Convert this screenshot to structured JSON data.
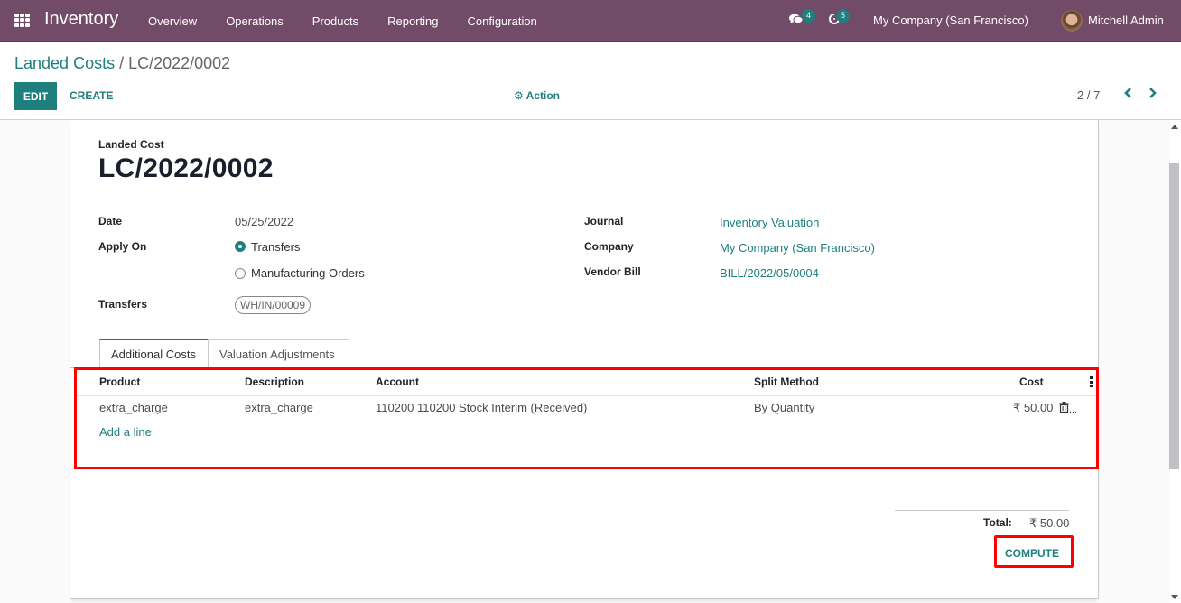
{
  "navbar": {
    "app_name": "Inventory",
    "menu": [
      "Overview",
      "Operations",
      "Products",
      "Reporting",
      "Configuration"
    ],
    "messages_count": "4",
    "activities_count": "5",
    "company": "My Company (San Francisco)",
    "user": "Mitchell Admin"
  },
  "breadcrumb": {
    "parent": "Landed Costs",
    "separator": " / ",
    "current": "LC/2022/0002"
  },
  "toolbar": {
    "edit_label": "EDIT",
    "create_label": "CREATE",
    "action_label": "Action",
    "pager": "2 / 7",
    "prev_icon": "‹",
    "next_icon": "›"
  },
  "form": {
    "subtitle": "Landed Cost",
    "title": "LC/2022/0002",
    "date_label": "Date",
    "date_value": "05/25/2022",
    "apply_on_label": "Apply On",
    "apply_on_options": [
      "Transfers",
      "Manufacturing Orders"
    ],
    "apply_on_selected": "Transfers",
    "transfers_label": "Transfers",
    "transfers_tag": "WH/IN/00009",
    "journal_label": "Journal",
    "journal_value": "Inventory Valuation",
    "company_label": "Company",
    "company_value": "My Company (San Francisco)",
    "vendor_bill_label": "Vendor Bill",
    "vendor_bill_value": "BILL/2022/05/0004"
  },
  "tabs": [
    {
      "label": "Additional Costs",
      "active": true
    },
    {
      "label": "Valuation Adjustments",
      "active": false
    }
  ],
  "cost_lines": {
    "columns": [
      "Product",
      "Description",
      "Account",
      "Split Method",
      "Cost"
    ],
    "rows": [
      {
        "product": "extra_charge",
        "description": "extra_charge",
        "account": "110200 110200 Stock Interim (Received)",
        "split_method": "By Quantity",
        "cost": "₹ 50.00"
      }
    ],
    "add_line_label": "Add a line"
  },
  "totals": {
    "total_label": "Total:",
    "total_value": "₹ 50.00",
    "compute_label": "COMPUTE"
  },
  "colors": {
    "navbar": "#714b67",
    "primary": "#1f7e7e",
    "highlight": "#ff0000"
  }
}
